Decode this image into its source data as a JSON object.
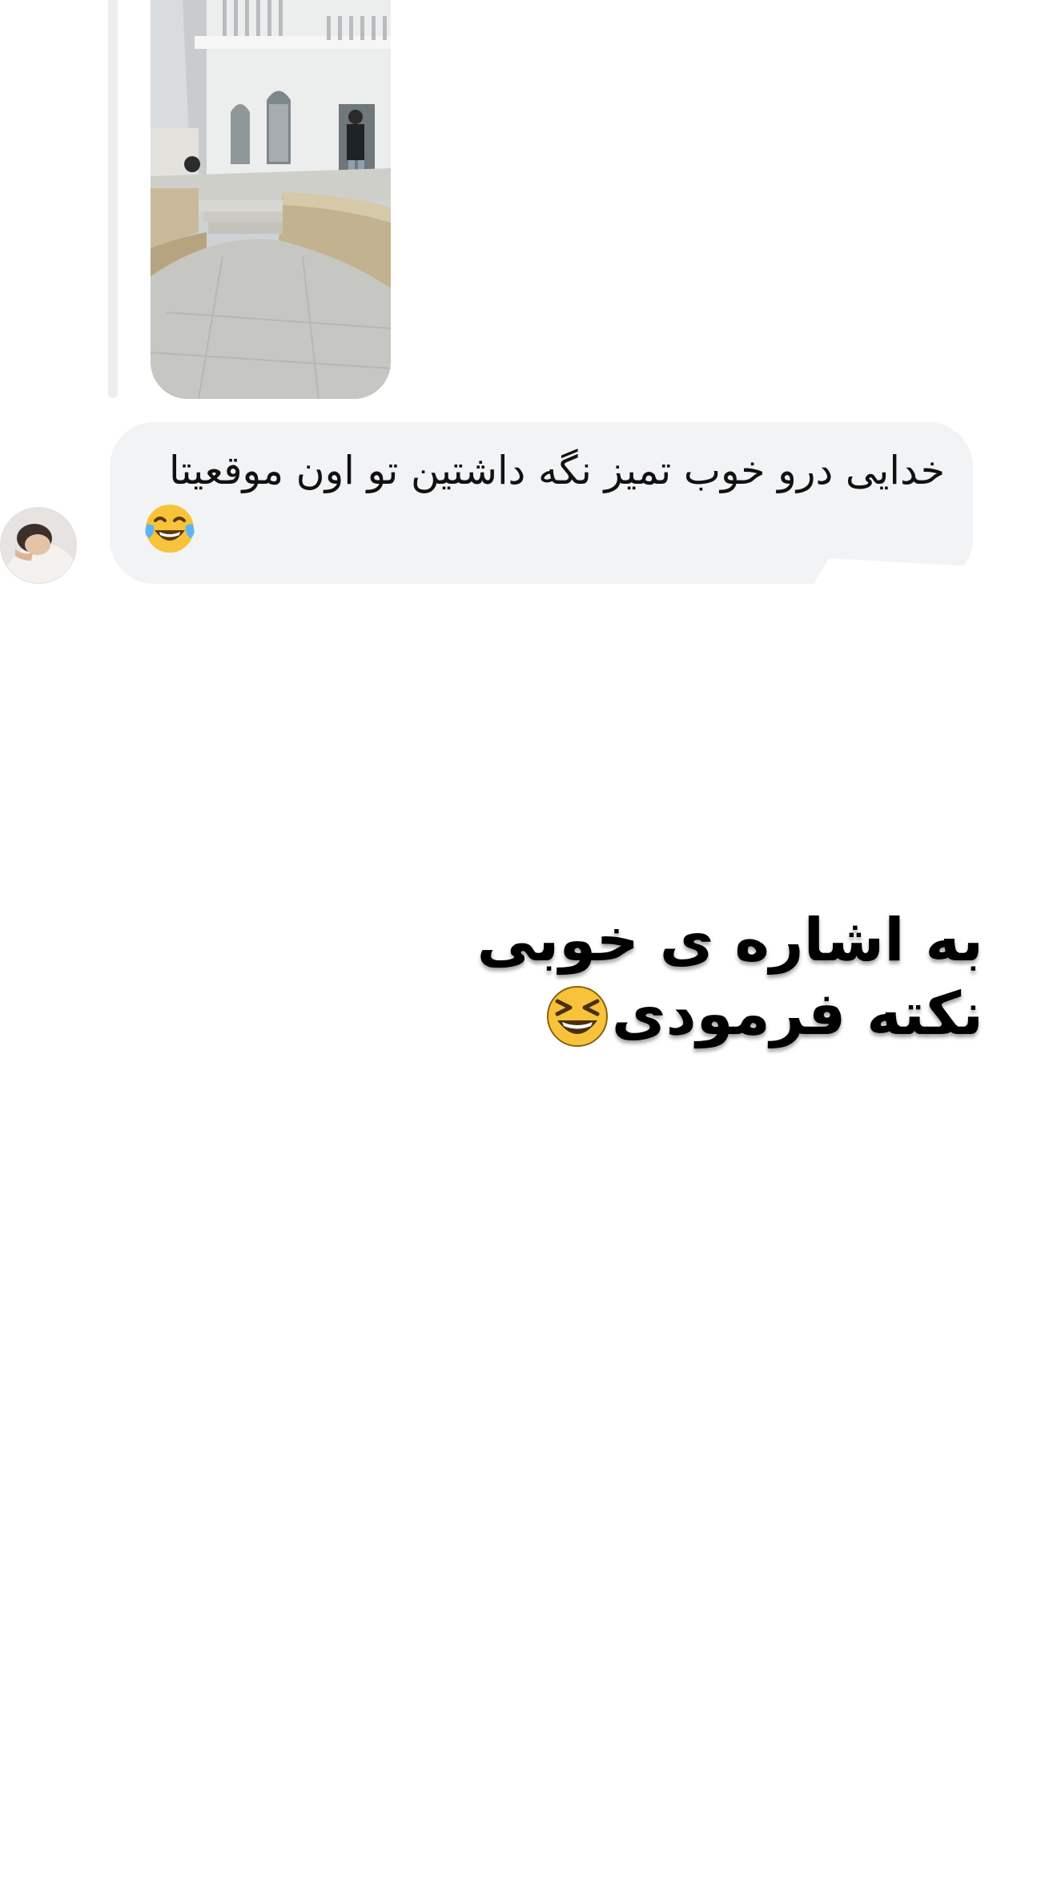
{
  "thread": {
    "shared_photo": {
      "alt": "",
      "image_subject": "villa-courtyard-photo"
    },
    "message": {
      "sender_avatar": "avatar-photo",
      "text": "خدایی درو خوب تمیز نگه داشتین تو اون موقعیتا",
      "emoji": "face-with-tears-of-joy-icon"
    }
  },
  "caption": {
    "line1": "به اشاره ی خوبی",
    "line2": "نکته فرمودی",
    "emoji": "grinning-squinting-face-icon"
  },
  "colors": {
    "bubble_bg": "#f2f3f5",
    "reply_line": "#eceef1",
    "text": "#111111",
    "emoji_yellow": "#f7c33a"
  }
}
